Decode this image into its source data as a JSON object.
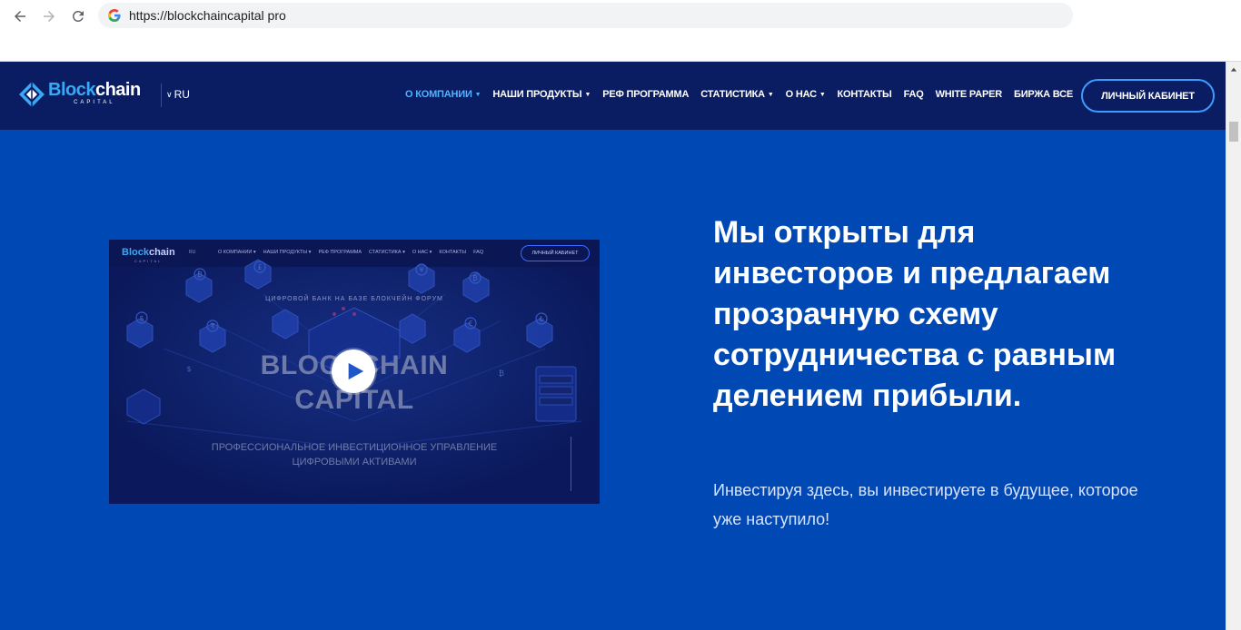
{
  "browser": {
    "url": "https://blockchaincapital pro",
    "icons": [
      "back-arrow-icon",
      "forward-arrow-icon",
      "reload-icon",
      "google-icon"
    ]
  },
  "header": {
    "logo_word_1": "Block",
    "logo_word_2": "chain",
    "logo_sub": "CAPITAL",
    "language": "RU",
    "menu": [
      {
        "label": "О КОМПАНИИ",
        "dropdown": true,
        "active": true
      },
      {
        "label": "НАШИ ПРОДУКТЫ",
        "dropdown": true,
        "active": false
      },
      {
        "label": "РЕФ ПРОГРАММА",
        "dropdown": false,
        "active": false
      },
      {
        "label": "СТАТИСТИКА",
        "dropdown": true,
        "active": false
      },
      {
        "label": "О НАС",
        "dropdown": true,
        "active": false
      },
      {
        "label": "КОНТАКТЫ",
        "dropdown": false,
        "active": false
      },
      {
        "label": "FAQ",
        "dropdown": false,
        "active": false
      },
      {
        "label": "WHITE PAPER",
        "dropdown": false,
        "active": false
      },
      {
        "label": "БИРЖА ВСЕ",
        "dropdown": false,
        "active": false
      }
    ],
    "cabinet_button": "ЛИЧНЫЙ КАБИНЕТ"
  },
  "video": {
    "logo_word_1": "Block",
    "logo_word_2": "chain",
    "logo_sub": "CAPITAL",
    "language": "RU",
    "menu": [
      "О КОМПАНИИ ▾",
      "НАШИ ПРОДУКТЫ ▾",
      "РЕФ ПРОГРАММА",
      "СТАТИСТИКА ▾",
      "О НАС ▾",
      "КОНТАКТЫ",
      "FAQ"
    ],
    "cabinet_button": "ЛИЧНЫЙ КАБИНЕТ",
    "kicker": "ЦИФРОВОЙ БАНК НА БАЗЕ БЛОКЧЕЙН ФОРУМ",
    "title_line_1": "BLOCKCHAIN",
    "title_line_2": "CAPITAL",
    "description_line_1": "ПРОФЕССИОНАЛЬНОЕ ИНВЕСТИЦИОННОЕ УПРАВЛЕНИЕ",
    "description_line_2": "ЦИФРОВЫМИ АКТИВАМИ",
    "currency_symbols": [
      "₿",
      "£",
      "¥",
      "₿",
      "$",
      "₹",
      "€",
      "₺",
      "$",
      "₿"
    ]
  },
  "hero": {
    "title": "Мы открыты для инвесторов и предлагаем прозрачную схему сотрудничества с равным делением прибыли.",
    "subtitle": "Инвестируя здесь, вы инвестируете в будущее, которое уже наступило!"
  },
  "colors": {
    "header_bg": "#0a1d63",
    "hero_bg": "#0049b4",
    "accent": "#39a8f5",
    "active_menu": "#4fb3ff"
  }
}
